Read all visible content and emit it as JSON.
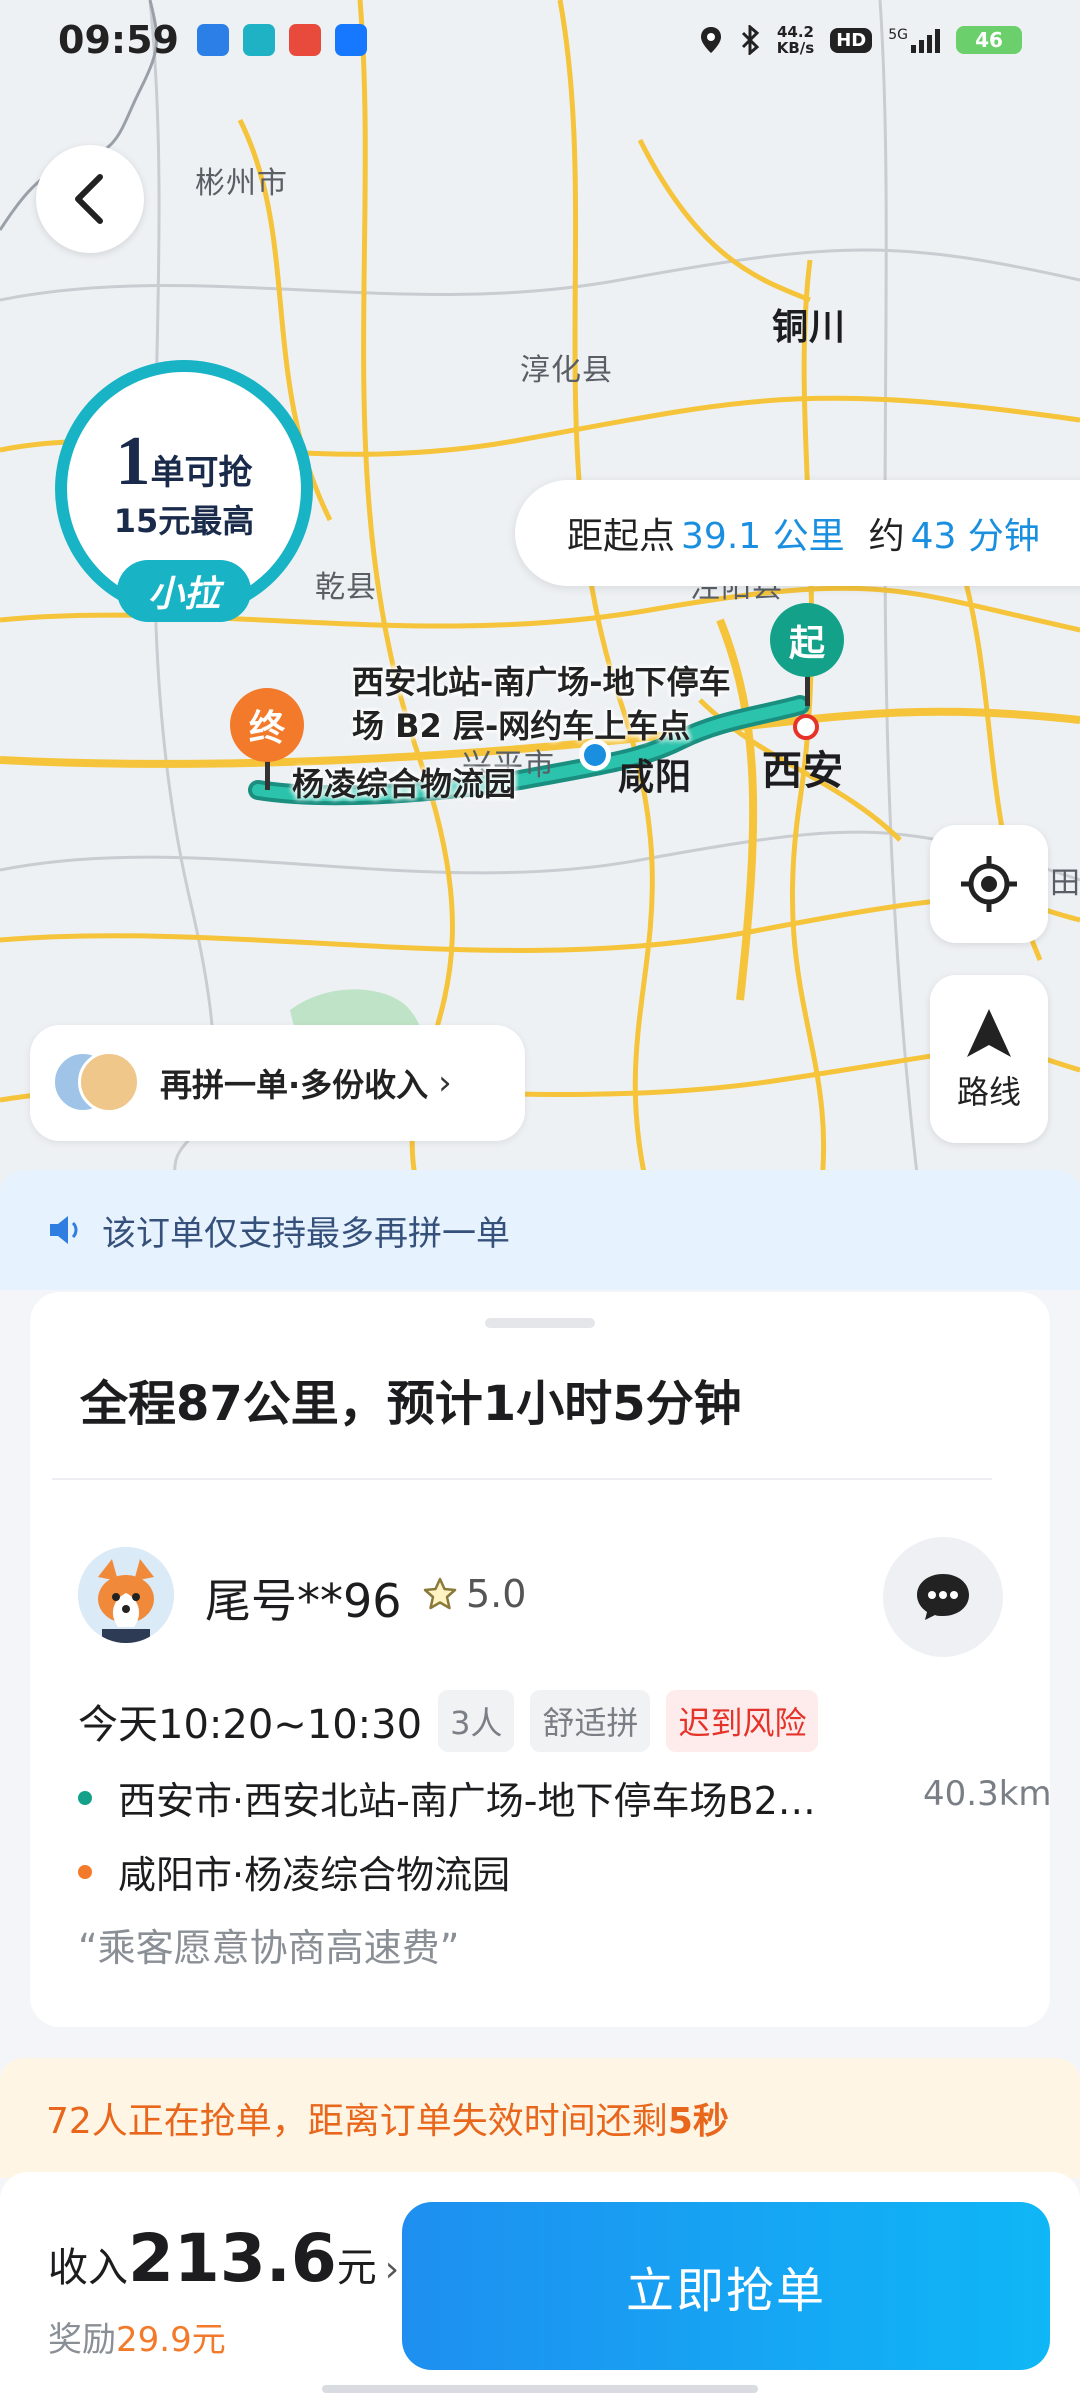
{
  "status_bar": {
    "time": "09:59",
    "speed_value": "44.2",
    "speed_unit": "KB/s",
    "hd": "HD",
    "network": "5G",
    "battery": "46",
    "icons": [
      "location-icon",
      "bluetooth-icon",
      "signal-icon",
      "battery-icon"
    ]
  },
  "map": {
    "place_labels": {
      "binzhou": "彬州市",
      "tongchuan": "铜川",
      "chunhua": "淳化县",
      "qianxian": "乾县",
      "xingping": "兴平市",
      "xianyang": "咸阳",
      "xian": "西安",
      "partial_right": "田",
      "partial_mid": "泾阳县"
    },
    "route_colors": {
      "route": "#1db3a0",
      "start": "#13a18a",
      "end": "#f27a2a"
    }
  },
  "order_badge": {
    "count": "1",
    "count_suffix": "单可抢",
    "max_text": "15元最高",
    "brand": "小拉"
  },
  "distance_pill": {
    "prefix": "距起点",
    "distance": "39.1 公里",
    "mid": "约",
    "duration": "43 分钟"
  },
  "pins": {
    "start": "起",
    "end": "终"
  },
  "route_labels": {
    "start": "西安北站-南广场-地下停车场B2层-网约车上车点",
    "start_line1": "西安北站-南广场-地下停车",
    "start_line2": "场 B2 层-网约车上车点",
    "end": "杨凌综合物流园"
  },
  "map_controls": {
    "route_label": "路线"
  },
  "pool_pill": {
    "text": "再拼一单·多份收入",
    "chevron": "›"
  },
  "notice": {
    "text": "该订单仅支持最多再拼一单"
  },
  "trip": {
    "headline": "全程87公里，预计1小时5分钟",
    "passenger_name": "尾号**96",
    "rating": "5.0",
    "time_window": "今天10:20~10:30",
    "tags": [
      "3人",
      "舒适拼",
      "迟到风险"
    ],
    "pickup": "西安市·西安北站-南广场-地下停车场B2…",
    "pickup_distance": "40.3km",
    "dropoff": "咸阳市·杨凌综合物流园",
    "note": "“乘客愿意协商高速费”"
  },
  "warning": {
    "prefix": "72人正在抢单，距离订单失效时间还剩",
    "seconds": "5秒"
  },
  "bottom": {
    "income_prefix": "收入",
    "income_amount": "213.6",
    "income_suffix": "元",
    "reward_prefix": "奖励",
    "reward_value": "29.9元",
    "grab_button": "立即抢单"
  }
}
